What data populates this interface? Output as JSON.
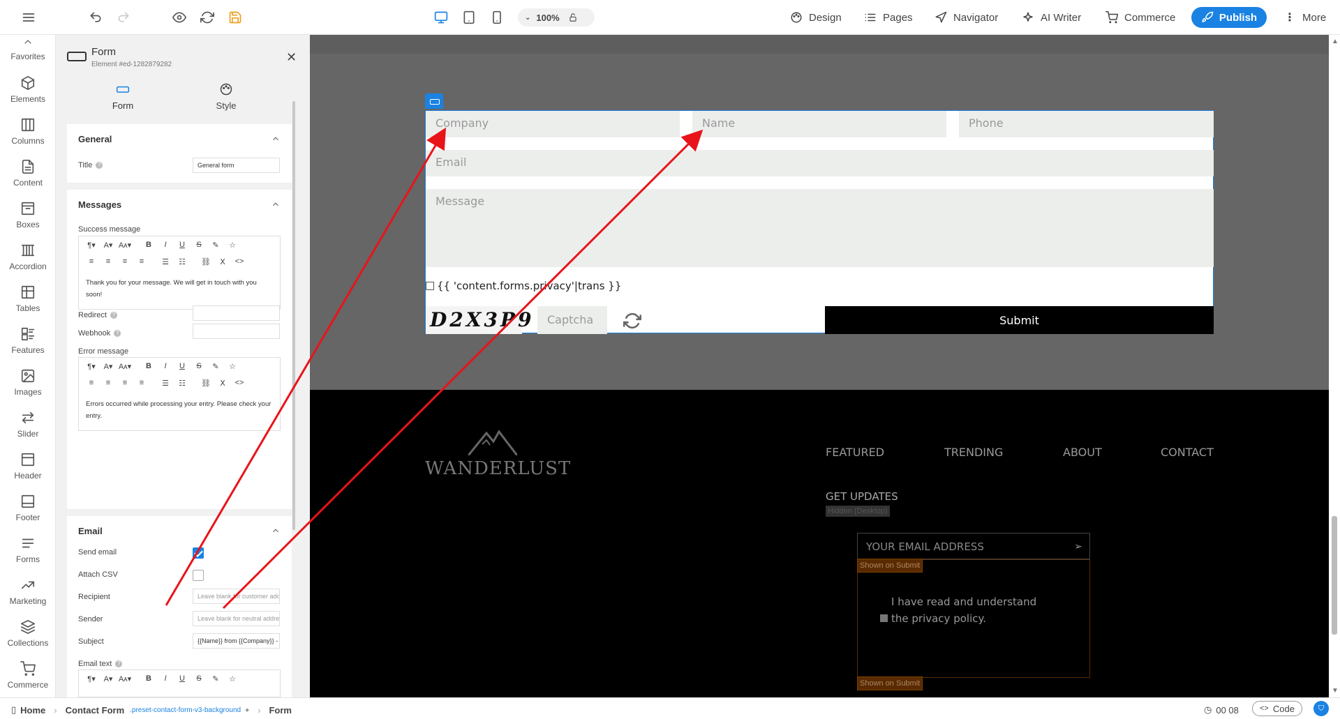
{
  "topbar": {
    "zoom": "100%",
    "nav": {
      "design": "Design",
      "pages": "Pages",
      "navigator": "Navigator",
      "ai_writer": "AI Writer",
      "commerce": "Commerce",
      "publish": "Publish",
      "more": "More"
    }
  },
  "sidebar": {
    "items": [
      {
        "label": "Favorites",
        "icon": "chevron-up-icon"
      },
      {
        "label": "Elements",
        "icon": "cube-icon"
      },
      {
        "label": "Columns",
        "icon": "columns-icon"
      },
      {
        "label": "Content",
        "icon": "document-icon"
      },
      {
        "label": "Boxes",
        "icon": "box-icon"
      },
      {
        "label": "Accordion",
        "icon": "accordion-icon"
      },
      {
        "label": "Tables",
        "icon": "table-icon"
      },
      {
        "label": "Features",
        "icon": "features-icon"
      },
      {
        "label": "Images",
        "icon": "image-icon"
      },
      {
        "label": "Slider",
        "icon": "slider-icon"
      },
      {
        "label": "Header",
        "icon": "header-icon"
      },
      {
        "label": "Footer",
        "icon": "footer-icon"
      },
      {
        "label": "Forms",
        "icon": "forms-icon"
      },
      {
        "label": "Marketing",
        "icon": "chart-up-icon"
      },
      {
        "label": "Collections",
        "icon": "layers-icon"
      },
      {
        "label": "Commerce",
        "icon": "cart-icon"
      }
    ]
  },
  "panel": {
    "title": "Form",
    "subtitle": "Element #ed-1282879282",
    "tabs": {
      "form": "Form",
      "style": "Style"
    },
    "general": {
      "title": "General",
      "title_label": "Title",
      "title_value": "General form"
    },
    "messages": {
      "title": "Messages",
      "success_label": "Success message",
      "success_text": "Thank you for your message. We will get in touch with you soon!",
      "redirect_label": "Redirect",
      "webhook_label": "Webhook",
      "error_label": "Error message",
      "error_text": "Errors occurred while processing your entry. Please check your entry."
    },
    "email": {
      "title": "Email",
      "send_label": "Send email",
      "attach_label": "Attach CSV",
      "recipient_label": "Recipient",
      "recipient_placeholder": "Leave blank for customer address...",
      "sender_label": "Sender",
      "sender_placeholder": "Leave blank for neutral address (noreply...",
      "subject_label": "Subject",
      "subject_value": "{{Name}} from {{Company}} - Contact re",
      "email_text_label": "Email text"
    },
    "toolbar": {
      "row1": [
        "¶▾",
        "A▾",
        "AA▾",
        "B",
        "I",
        "U",
        "S",
        "✎",
        "☆"
      ],
      "row2": [
        "≡",
        "≡",
        "≡",
        "≡",
        "☰",
        "☷",
        "⛓",
        "Ⅹ",
        "<>"
      ]
    }
  },
  "form": {
    "company_placeholder": "Company",
    "name_placeholder": "Name",
    "phone_placeholder": "Phone",
    "email_placeholder": "Email",
    "message_placeholder": "Message",
    "privacy_text": "{{ 'content.forms.privacy'|trans }}",
    "captcha_text": "D2X3P9",
    "captcha_placeholder": "Captcha",
    "submit_label": "Submit"
  },
  "footer": {
    "logo_text": "WANDERLUST",
    "nav": [
      "FEATURED",
      "TRENDING",
      "ABOUT",
      "CONTACT"
    ],
    "get_updates": "GET UPDATES",
    "hidden_tag": "Hidden (Desktop)",
    "email_placeholder": "YOUR EMAIL ADDRESS",
    "shown_tag": "Shown on Submit",
    "agree_text": "I have read and understand the privacy policy."
  },
  "statusbar": {
    "home": "Home",
    "page": "Contact Form",
    "preset": ".preset-contact-form-v3-background",
    "element": "Form",
    "time": "00 08",
    "code": "Code"
  },
  "colors": {
    "accent": "#1a82e2",
    "arrow": "#e8141a"
  }
}
